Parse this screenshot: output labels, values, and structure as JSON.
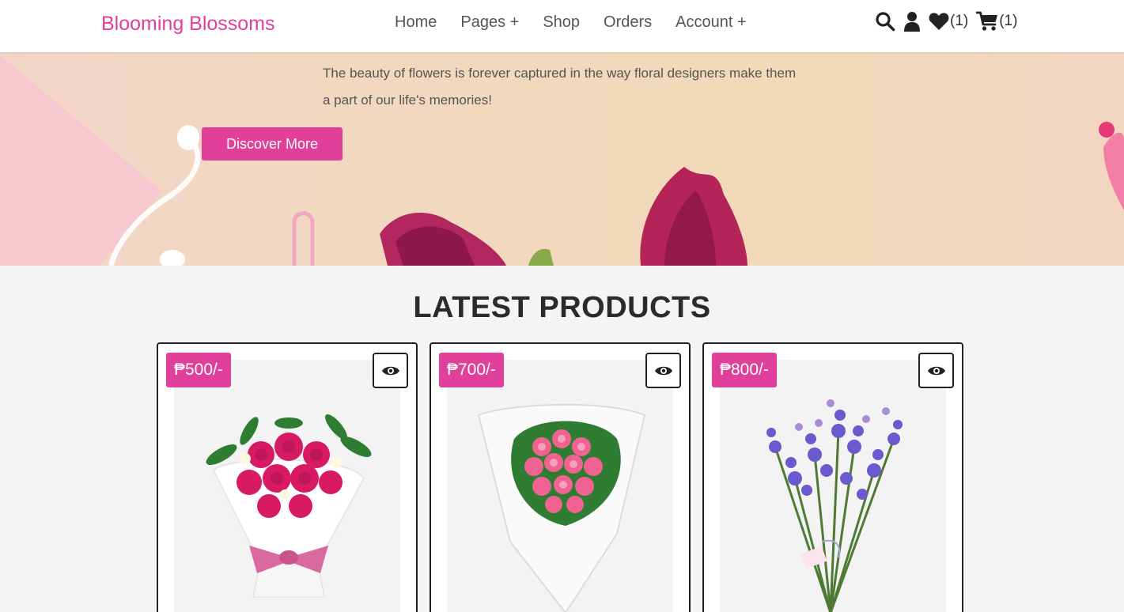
{
  "header": {
    "logo": "Blooming Blossoms",
    "nav": [
      "Home",
      "Pages +",
      "Shop",
      "Orders",
      "Account +"
    ],
    "icons": [
      "search-icon",
      "user-icon",
      "heart-icon",
      "cart-icon"
    ],
    "wishlist_count": "(1)",
    "cart_count": "(1)"
  },
  "hero": {
    "text": "The beauty of flowers is forever captured in the way floral designers make them a part of our life's memories!",
    "button": "Discover More"
  },
  "products": {
    "title": "LATEST PRODUCTS",
    "items": [
      {
        "price": "₱500/-"
      },
      {
        "price": "₱700/-"
      },
      {
        "price": "₱800/-"
      }
    ]
  },
  "colors": {
    "accent": "#e0409a"
  }
}
